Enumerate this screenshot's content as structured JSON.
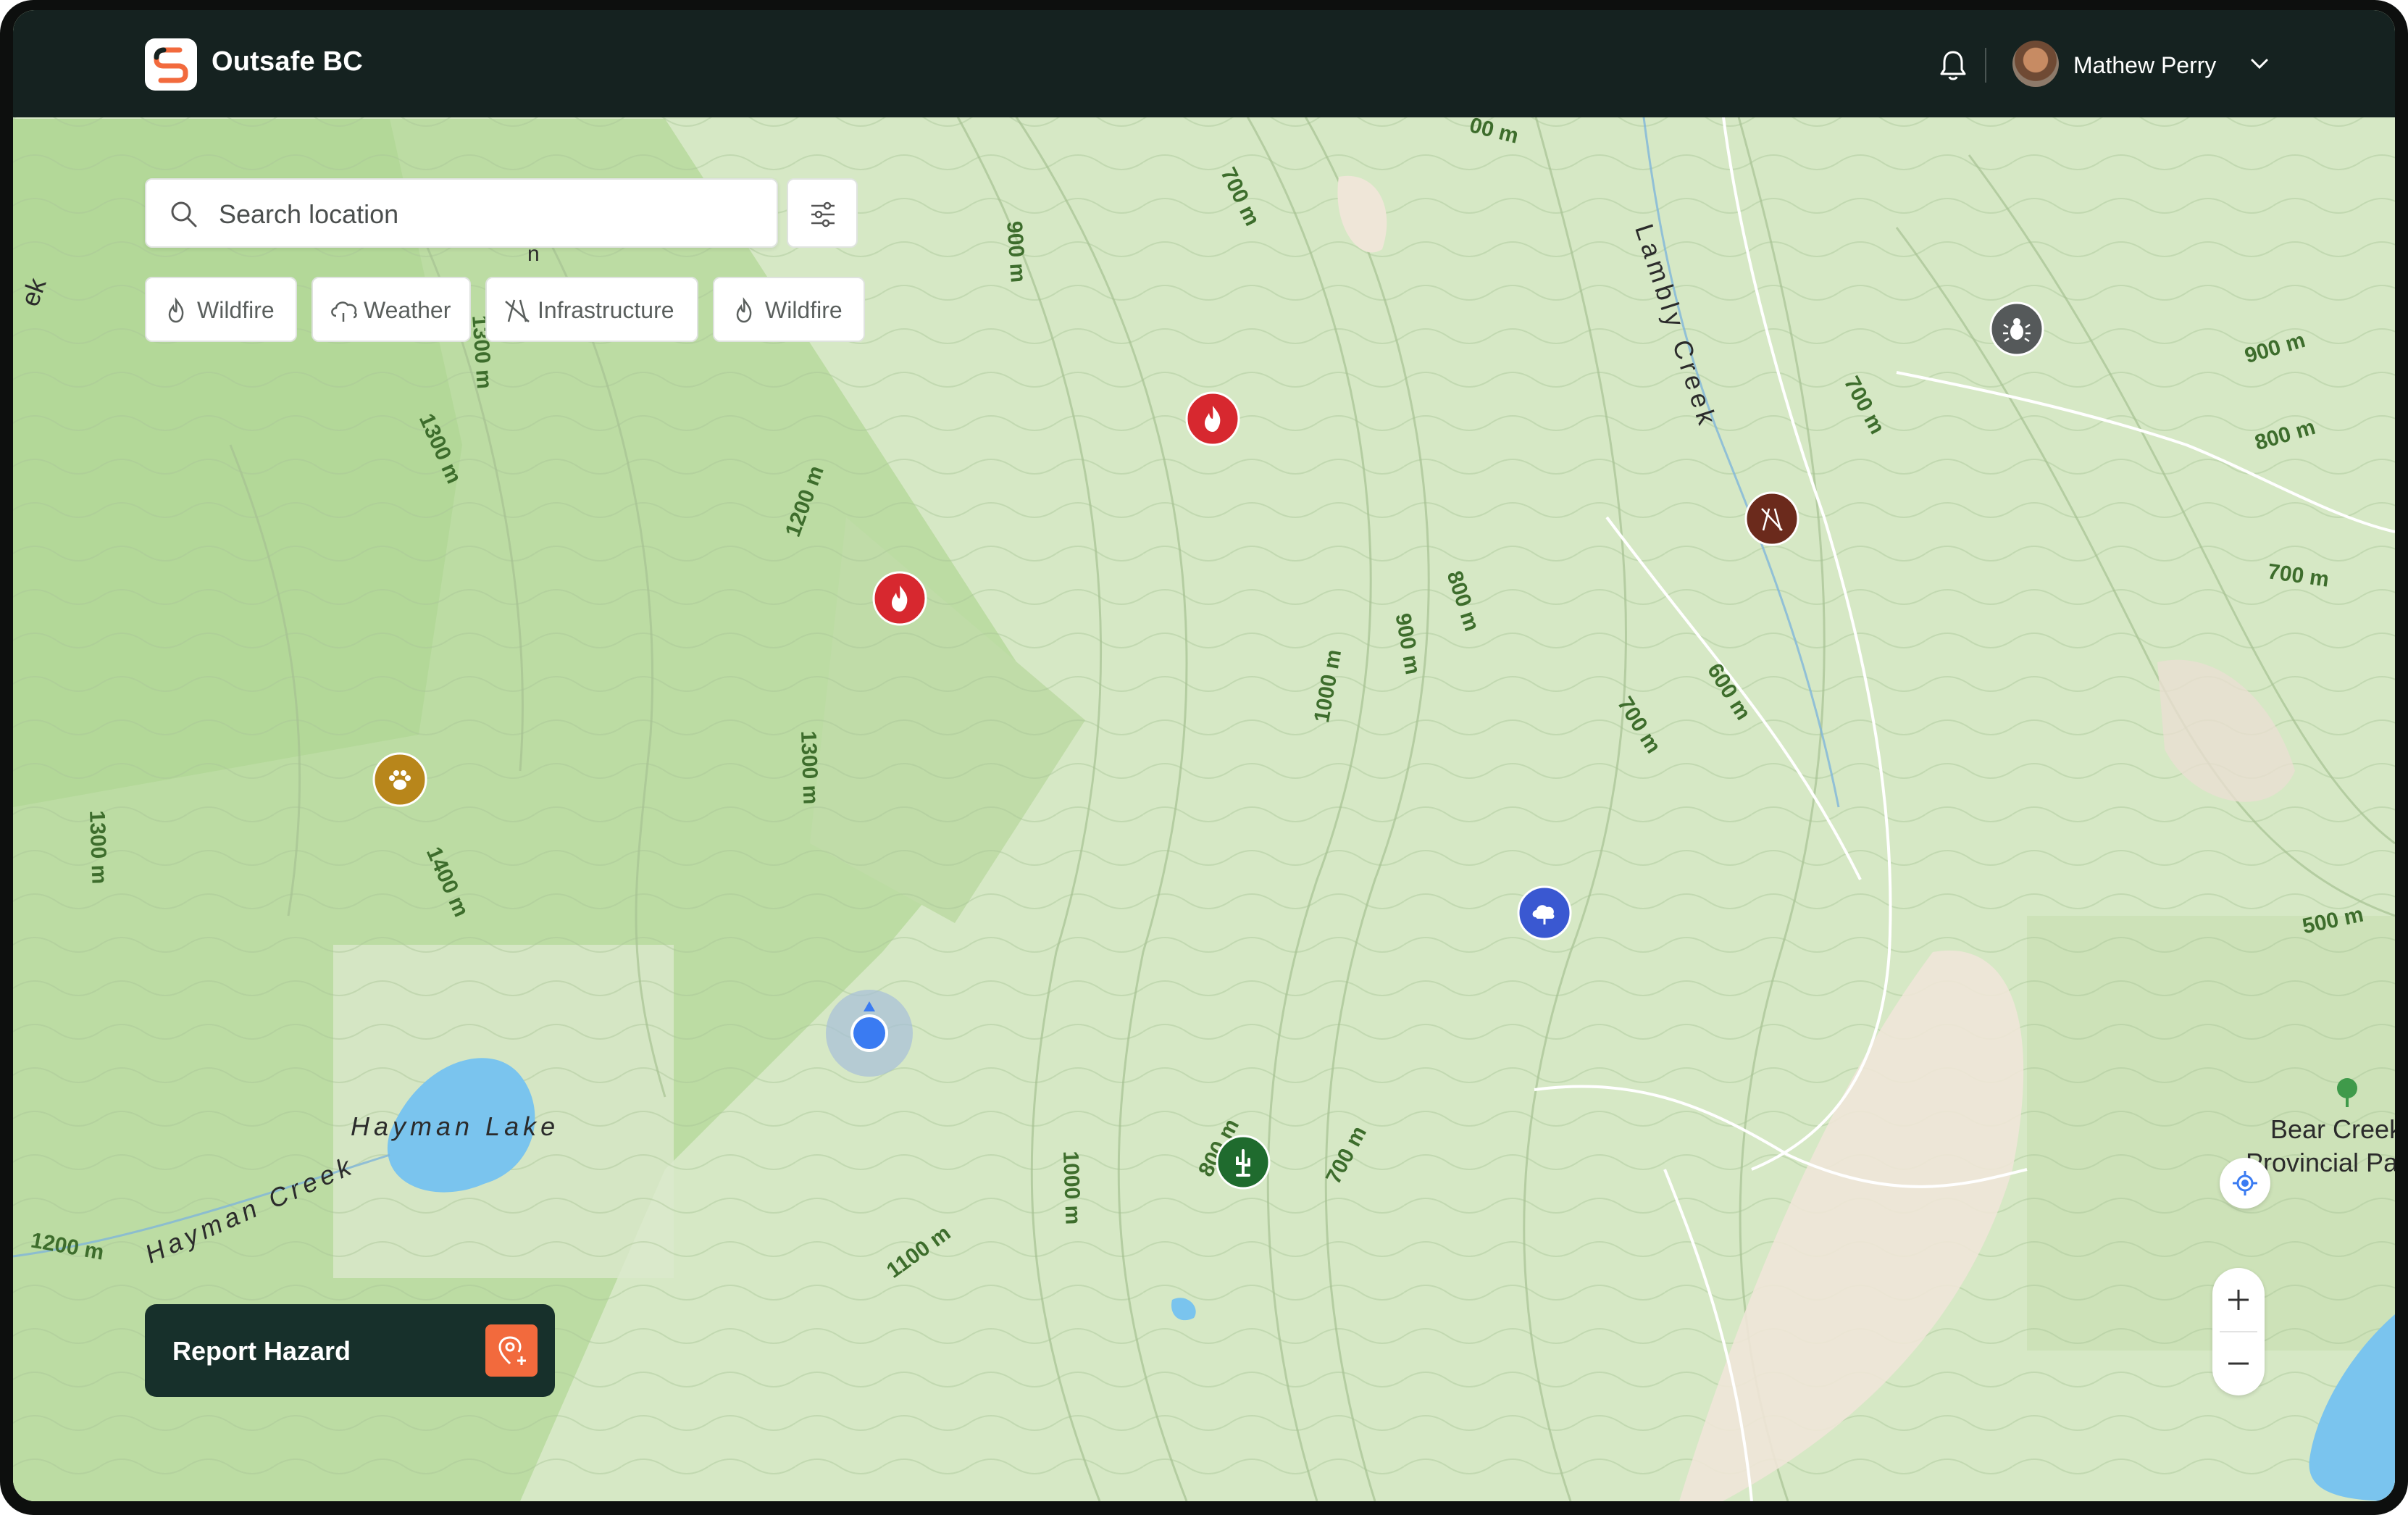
{
  "app": {
    "brand_name": "Outsafe BC",
    "user_name": "Mathew Perry"
  },
  "search": {
    "placeholder": "Search location"
  },
  "filters": [
    {
      "label": "Wildfire",
      "icon": "flame-icon"
    },
    {
      "label": "Weather",
      "icon": "cloud-rain-icon"
    },
    {
      "label": "Infrastructure",
      "icon": "broken-structure-icon"
    },
    {
      "label": "Wildfire",
      "icon": "flame-icon"
    }
  ],
  "report": {
    "label": "Report Hazard",
    "icon": "location-plus-icon"
  },
  "map": {
    "places": {
      "hayman_lake": "Hayman Lake",
      "hayman_creek": "Hayman Creek",
      "lambly_creek": "Lambly Creek",
      "bear_creek_line1": "Bear Creek",
      "bear_creek_line2": "Provincial Pa",
      "creek_fragment": "ek",
      "m_fragment": "n"
    },
    "contour_labels": [
      "500 m",
      "700 m",
      "900 m",
      "1200 m",
      "1300 m",
      "1400 m",
      "1300 m",
      "900 m",
      "800 m",
      "700 m",
      "1300 m",
      "1000 m",
      "900 m",
      "800 m",
      "700 m",
      "600 m",
      "700 m",
      "900 m",
      "800 m",
      "700 m",
      "500 m",
      "800 m",
      "700 m",
      "1000 m",
      "1100 m",
      "1200 m",
      "1300 m",
      "00 m"
    ],
    "markers": [
      {
        "type": "wildfire",
        "icon": "flame-icon",
        "color": "#d7282f"
      },
      {
        "type": "wildfire",
        "icon": "flame-icon",
        "color": "#d7282f"
      },
      {
        "type": "wildlife",
        "icon": "paw-icon",
        "color": "#b8861b"
      },
      {
        "type": "insect",
        "icon": "bug-icon",
        "color": "#55595a"
      },
      {
        "type": "infrastructure",
        "icon": "broken-structure-icon",
        "color": "#6b2a1c"
      },
      {
        "type": "weather",
        "icon": "cloud-rain-icon",
        "color": "#3a58d1"
      },
      {
        "type": "vegetation",
        "icon": "cactus-icon",
        "color": "#1f6b2e"
      },
      {
        "type": "user-location",
        "icon": "current-location-icon",
        "color": "#3a7bf2"
      }
    ]
  },
  "colors": {
    "topbar": "#152220",
    "accent": "#f26a3d",
    "report_bg": "#17302b",
    "map_base": "#d4e6c1",
    "forest": "#b5d89a",
    "water": "#7ac4ee"
  }
}
